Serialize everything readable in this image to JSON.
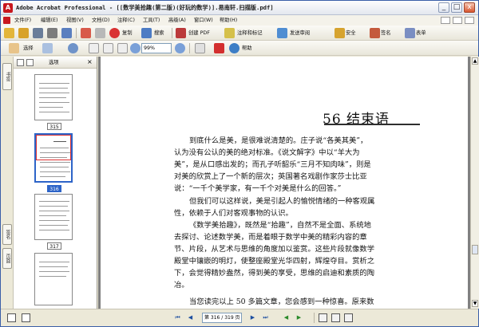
{
  "window": {
    "title": "Adobe Acrobat Professional - [[数学美拾趣(第二版)(好玩的数学)].易南轩.扫描版.pdf]",
    "icon_letter": "A",
    "minimize_label": "_",
    "maximize_label": "□",
    "close_label": "x"
  },
  "menu": {
    "items": [
      "文件(F)",
      "编辑(E)",
      "视图(V)",
      "文档(D)",
      "注释(C)",
      "工具(T)",
      "高级(A)",
      "窗口(W)",
      "帮助(H)"
    ]
  },
  "toolbar1": {
    "print_label": "复制",
    "search_label": "搜索",
    "create_pdf_label": "创建 PDF",
    "comment_label": "注释和标记",
    "send_review_label": "发送审阅",
    "secure_label": "安全",
    "sign_label": "签名",
    "form_label": "表单"
  },
  "toolbar2": {
    "select_label": "选择",
    "zoom_value": "99%",
    "help_label": "帮助"
  },
  "nav": {
    "header_label": "选项",
    "tabs": [
      "书签",
      "签名",
      "页面"
    ],
    "thumbnails": [
      {
        "page": "315",
        "selected": false
      },
      {
        "page": "316",
        "selected": true
      },
      {
        "page": "317",
        "selected": false
      }
    ]
  },
  "document": {
    "chapter_title": "56 结束语",
    "lines": [
      "到底什么是美，是很难说清楚的。庄子说“各美其美”，",
      "认为没有公认的美的绝对标准。《说文解字》中以“羊大为",
      "美”，是从口感出发的；而孔子听韶乐“三月不知肉味”，则是",
      "对美的欣赏上了一个新的层次；英国著名戏剧作家莎士比亚",
      "说：“一千个美学家，有一千个对美是什么的回答。”",
      "但我们可以这样说，美是引起人的愉悦情绪的一种客观属",
      "性，依赖于人们对客观事物的认识。",
      "《数学美拾趣》，既然是“拾趣”，自然不是全面、系统地",
      "去探讨、论述数学美，而是着眼于数学中美的精彩内容的章",
      "节、片段，从艺术与思维的角度加以鉴赏。这些片段就像数学",
      "殿堂中镶嵌的明灯，使整座殿堂光华四射，辉煌夺目。赏析之",
      "下，会觉得精妙盎然，得到美的享受，思维的启迪和素质的陶",
      "冶。",
      "当您读完以上 50 多篇文章，您会感到一种惊喜。原来数"
    ]
  },
  "status": {
    "page_indicator": "第 316 / 319 页"
  },
  "colors": {
    "accent": "#2d64c8",
    "adobe_red": "#c8171e"
  }
}
